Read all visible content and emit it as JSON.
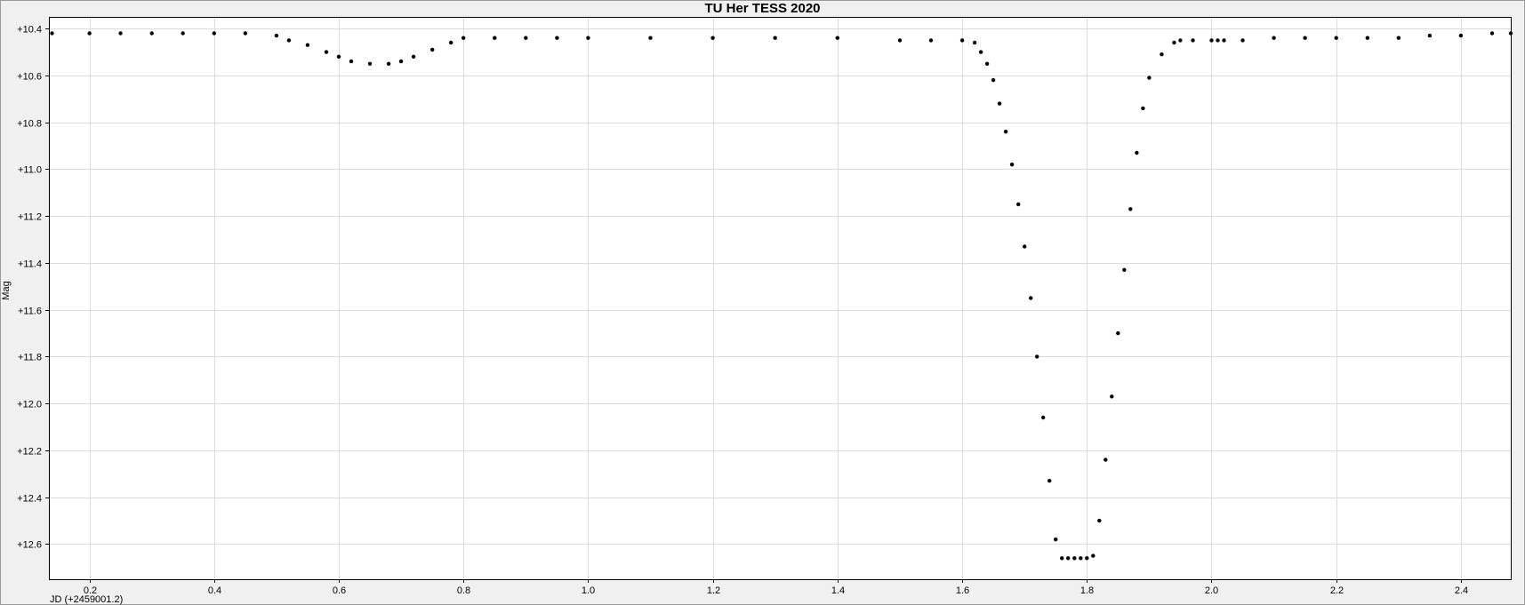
{
  "window": {
    "background": "#f0f0f0"
  },
  "chart_data": {
    "type": "scatter",
    "title": "TU Her TESS 2020",
    "xlabel": "JD (+2459001.2)",
    "ylabel": "Mag",
    "xlim": [
      0.135,
      2.48
    ],
    "ylim": [
      10.35,
      12.75
    ],
    "y_inverted": true,
    "grid": true,
    "x_ticks": [
      "0.2",
      "0.4",
      "0.6",
      "0.8",
      "1.0",
      "1.2",
      "1.4",
      "1.6",
      "1.8",
      "2.0",
      "2.2",
      "2.4"
    ],
    "y_ticks": [
      "+10.4",
      "+10.6",
      "+10.8",
      "+11.0",
      "+11.2",
      "+11.4",
      "+11.6",
      "+11.8",
      "+12.0",
      "+12.2",
      "+12.4",
      "+12.6"
    ],
    "colors": {
      "plot_bg": "#ffffff",
      "grid": "#dcdcdc",
      "points": "#000000",
      "frame": "#000000"
    },
    "series": [
      {
        "x": [
          0.14,
          0.2,
          0.25,
          0.3,
          0.35,
          0.4,
          0.45,
          0.5,
          0.52,
          0.55,
          0.58,
          0.6,
          0.62,
          0.65,
          0.68,
          0.7,
          0.72,
          0.75,
          0.78,
          0.8,
          0.85,
          0.9,
          0.95,
          1.0,
          1.1,
          1.2,
          1.3,
          1.4,
          1.5,
          1.55,
          1.6,
          1.62,
          1.63,
          1.64,
          1.65,
          1.66,
          1.67,
          1.68,
          1.69,
          1.7,
          1.71,
          1.72,
          1.73,
          1.74,
          1.75,
          1.76,
          1.77,
          1.78,
          1.79,
          1.8,
          1.81,
          1.82,
          1.83,
          1.84,
          1.85,
          1.86,
          1.87,
          1.88,
          1.89,
          1.9,
          1.92,
          1.94,
          1.95,
          1.97,
          2.0,
          2.01,
          2.02,
          2.05,
          2.1,
          2.15,
          2.2,
          2.25,
          2.3,
          2.35,
          2.4,
          2.45,
          2.48
        ],
        "y": [
          10.42,
          10.42,
          10.42,
          10.42,
          10.42,
          10.42,
          10.42,
          10.43,
          10.45,
          10.47,
          10.5,
          10.52,
          10.54,
          10.55,
          10.55,
          10.54,
          10.52,
          10.49,
          10.46,
          10.44,
          10.44,
          10.44,
          10.44,
          10.44,
          10.44,
          10.44,
          10.44,
          10.44,
          10.45,
          10.45,
          10.45,
          10.46,
          10.5,
          10.55,
          10.62,
          10.72,
          10.84,
          10.98,
          11.15,
          11.33,
          11.55,
          11.8,
          12.06,
          12.33,
          12.58,
          12.66,
          12.66,
          12.66,
          12.66,
          12.66,
          12.65,
          12.5,
          12.24,
          11.97,
          11.7,
          11.43,
          11.17,
          10.93,
          10.74,
          10.61,
          10.51,
          10.46,
          10.45,
          10.45,
          10.45,
          10.45,
          10.45,
          10.45,
          10.44,
          10.44,
          10.44,
          10.44,
          10.44,
          10.43,
          10.43,
          10.42,
          10.42
        ]
      }
    ]
  }
}
